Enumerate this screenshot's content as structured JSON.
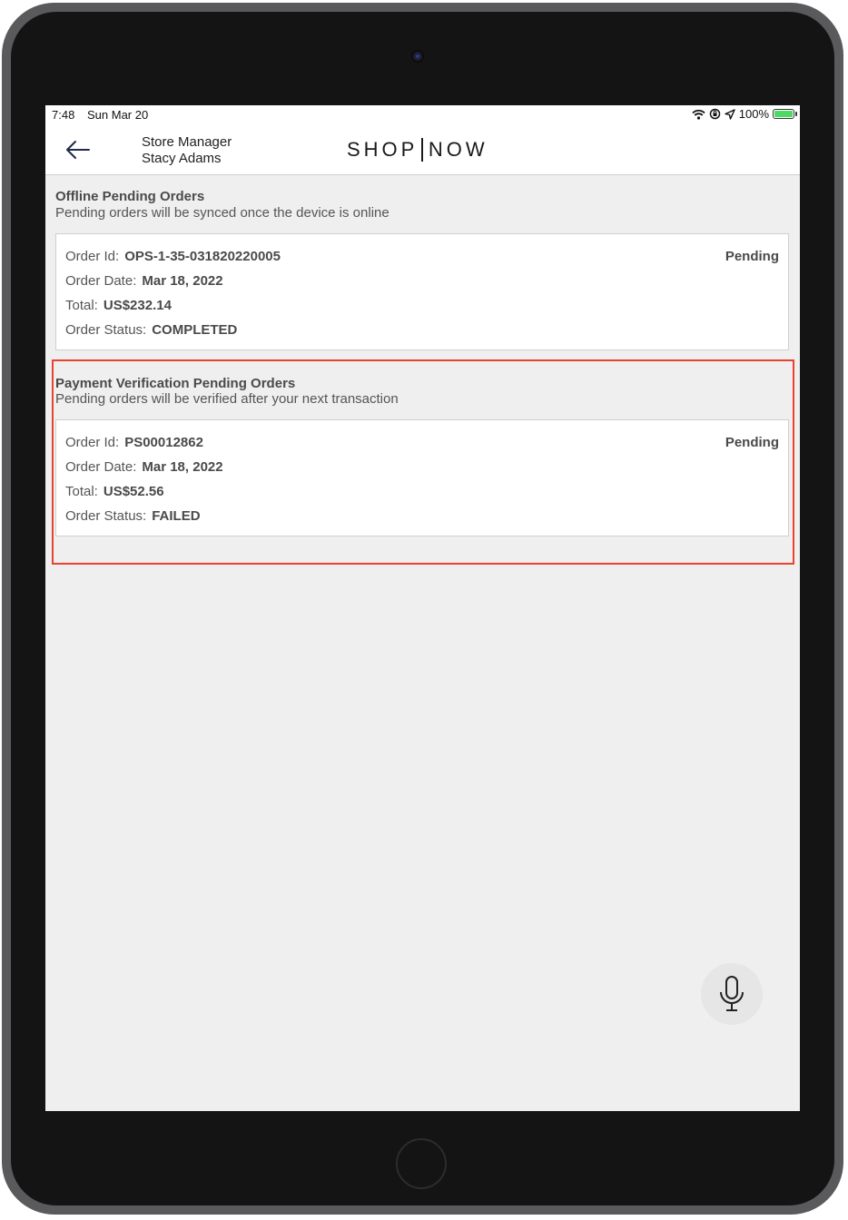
{
  "status_bar": {
    "time": "7:48",
    "date": "Sun Mar 20",
    "battery": "100%"
  },
  "header": {
    "user_role": "Store Manager",
    "user_name": "Stacy Adams",
    "brand_left": "SHOP",
    "brand_right": "NOW"
  },
  "offline": {
    "title": "Offline Pending Orders",
    "subtitle": "Pending orders will be synced once the device is online",
    "order": {
      "id_label": "Order Id:",
      "id": "OPS-1-35-031820220005",
      "date_label": "Order Date:",
      "date": "Mar 18, 2022",
      "total_label": "Total:",
      "total": "US$232.14",
      "status_label": "Order Status:",
      "status": "COMPLETED",
      "badge": "Pending"
    }
  },
  "payment": {
    "title": "Payment Verification Pending Orders",
    "subtitle": "Pending orders will be verified after your next transaction",
    "order": {
      "id_label": "Order Id:",
      "id": "PS00012862",
      "date_label": "Order Date:",
      "date": "Mar 18, 2022",
      "total_label": "Total:",
      "total": "US$52.56",
      "status_label": "Order Status:",
      "status": "FAILED",
      "badge": "Pending"
    }
  },
  "colors": {
    "highlight": "#e8432f",
    "battery": "#4cd964",
    "background": "#efefef"
  },
  "icons": [
    "back-arrow-icon",
    "wifi-icon",
    "orientation-lock-icon",
    "location-icon",
    "battery-icon",
    "microphone-icon"
  ]
}
